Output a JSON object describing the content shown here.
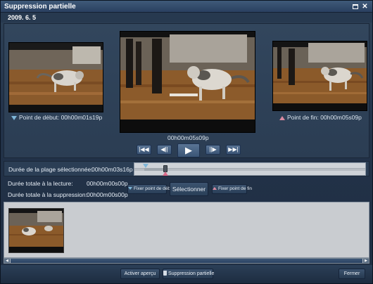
{
  "window": {
    "title": "Suppression partielle",
    "date": "2009. 6. 5"
  },
  "preview": {
    "start_label": "Point de début:",
    "start_time": "00h00m01s19p",
    "end_label": "Point de fin:",
    "end_time": "00h00m05s09p",
    "current_time": "00h00m05s09p"
  },
  "transport": {
    "first_icon": "skip-to-start-icon",
    "prev_icon": "frame-back-icon",
    "play_icon": "play-icon",
    "next_icon": "frame-forward-icon",
    "last_icon": "skip-to-end-icon"
  },
  "range": {
    "label": "Durée de la plage sélectionnée:",
    "value": "00h00m03s16p"
  },
  "totals": {
    "playback_label": "Durée totale à la lecture:",
    "playback_value": "00h00m00s00p",
    "deletion_label": "Durée totale à la suppression:",
    "deletion_value": "00h00m00s00p"
  },
  "buttons": {
    "fix_start": "Fixer point de début",
    "select": "Sélectionner",
    "fix_end": "Fixer point de fin",
    "preview": "Activer aperçu",
    "delete": "Suppression partielle",
    "close": "Fermer"
  },
  "colors": {
    "start_marker": "#7fb6d8",
    "end_marker": "#d96b8a"
  }
}
